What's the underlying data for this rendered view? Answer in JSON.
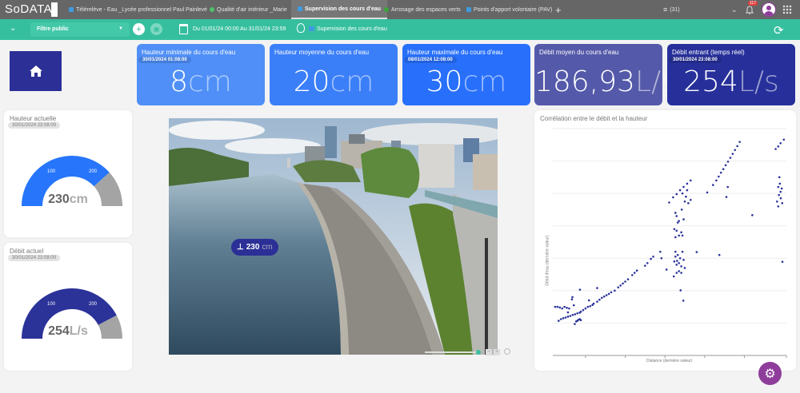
{
  "topbar": {
    "logo": "SoDATA",
    "tabs": [
      {
        "label": "Télérelève - Eau _Lycée professionnel Paul Painlevé",
        "icon": "water-meter-icon",
        "color": "#3f9be0"
      },
      {
        "label": "Qualité d'air intérieur _Marie",
        "icon": "leaf-icon",
        "color": "#4ec06c"
      },
      {
        "label": "Supervision des cours d'eau",
        "icon": "river-icon",
        "color": "#3f9be0",
        "active": true
      },
      {
        "label": "Arrosage des espaces verts",
        "icon": "tree-icon",
        "color": "#3ca53c"
      },
      {
        "label": "Points d'apport volontaire (PAV)",
        "icon": "bin-icon",
        "color": "#3f9be0"
      }
    ],
    "list_count": "(31)",
    "notifications": "117"
  },
  "toolbar": {
    "filter": "Filtre public",
    "date_range": "Du 01/01/24 00:00 Au 31/01/24 23:59",
    "dashboard": "Supervision des cours d'eau"
  },
  "kpis": [
    {
      "title": "Hauteur minimale du cours d'eau",
      "date": "30/01/2024 01:08:00",
      "value": "8",
      "unit": "cm",
      "color": "#4f8ff7"
    },
    {
      "title": "Hauteur moyenne du cours d'eau",
      "value": "20",
      "unit": "cm",
      "color": "#3b7ff8"
    },
    {
      "title": "Hauteur maximale du cours d'eau",
      "date": "08/01/2024 12:08:00",
      "value": "30",
      "unit": "cm",
      "color": "#2870fb"
    },
    {
      "title": "Débit moyen du cours d'eau",
      "value": "186,93",
      "unit": "L/s",
      "color": "#5459a9"
    },
    {
      "title": "Débit entrant (temps réel)",
      "date": "30/01/2024 23:08:00",
      "value": "254",
      "unit": "L/s",
      "color": "#27309a"
    }
  ],
  "gauges": [
    {
      "title": "Hauteur actuelle",
      "date": "30/01/2024 23:08:00",
      "value": "230",
      "unit": "cm",
      "level": 230,
      "max": 300,
      "ticks": [
        "100",
        "200"
      ],
      "color": "#2775fb"
    },
    {
      "title": "Débit actuel",
      "date": "30/01/2024 23:08:00",
      "value": "254",
      "unit": "L/s",
      "level": 254,
      "max": 300,
      "ticks": [
        "100",
        "200"
      ],
      "color": "#2b3399"
    }
  ],
  "photo_marker": {
    "value": "230",
    "unit": "cm"
  },
  "chart_data": {
    "type": "scatter",
    "title": "Corrélation entre le débit et la hauteur",
    "xlabel": "Distance (dernière valeur)",
    "ylabel": "Débit d'eau (dernière valeur)",
    "xlim": [
      0,
      100
    ],
    "ylim": [
      0,
      7
    ],
    "grid": true,
    "color": "#2b3399",
    "points": [
      [
        1,
        1.5
      ],
      [
        2,
        1.5
      ],
      [
        3,
        1.48
      ],
      [
        4,
        1.45
      ],
      [
        5,
        1.5
      ],
      [
        6,
        1.47
      ],
      [
        7,
        1.45
      ],
      [
        2.5,
        1.07
      ],
      [
        3.5,
        1.12
      ],
      [
        4.5,
        1.15
      ],
      [
        5.5,
        1.17
      ],
      [
        6.5,
        1.2
      ],
      [
        7.5,
        1.22
      ],
      [
        8.5,
        1.25
      ],
      [
        9.5,
        1.27
      ],
      [
        10.5,
        1.3
      ],
      [
        11.5,
        1.32
      ],
      [
        12,
        1.35
      ],
      [
        8.2,
        1.73
      ],
      [
        8.4,
        1.8
      ],
      [
        9,
        1.55
      ],
      [
        6.5,
        1.33
      ],
      [
        11.6,
        2.03
      ],
      [
        9.4,
        0.97
      ],
      [
        10,
        1.05
      ],
      [
        10.5,
        1.07
      ],
      [
        11,
        1.1
      ],
      [
        11.5,
        1.12
      ],
      [
        12,
        1.09
      ],
      [
        13,
        1.4
      ],
      [
        14,
        1.45
      ],
      [
        15,
        1.5
      ],
      [
        15.5,
        1.7
      ],
      [
        16,
        1.52
      ],
      [
        17,
        1.56
      ],
      [
        17.5,
        1.6
      ],
      [
        19,
        1.66
      ],
      [
        19,
        2.08
      ],
      [
        20,
        1.72
      ],
      [
        21,
        1.78
      ],
      [
        22,
        1.82
      ],
      [
        23,
        1.86
      ],
      [
        24,
        1.9
      ],
      [
        25,
        1.95
      ],
      [
        26.5,
        2
      ],
      [
        28,
        2.1
      ],
      [
        29,
        2.16
      ],
      [
        30,
        2.22
      ],
      [
        31,
        2.28
      ],
      [
        32.2,
        2.35
      ],
      [
        34,
        2.48
      ],
      [
        35,
        2.55
      ],
      [
        36,
        2.62
      ],
      [
        39.5,
        2.77
      ],
      [
        40.5,
        2.85
      ],
      [
        42,
        2.98
      ],
      [
        43,
        3.05
      ],
      [
        46,
        3.2
      ],
      [
        46.5,
        3
      ],
      [
        48.7,
        2.65
      ],
      [
        51.8,
        2.44
      ],
      [
        52,
        2.9
      ],
      [
        52.5,
        3.05
      ],
      [
        53,
        2.8
      ],
      [
        53.2,
        2.92
      ],
      [
        53.5,
        3.1
      ],
      [
        54,
        2.85
      ],
      [
        54.5,
        3
      ],
      [
        55,
        2.75
      ],
      [
        55.5,
        3.2
      ],
      [
        56,
        2.95
      ],
      [
        52.5,
        3.2
      ],
      [
        54,
        2.6
      ],
      [
        55,
        2.55
      ],
      [
        56.5,
        2.7
      ],
      [
        53,
        2.55
      ],
      [
        54.7,
        2.01
      ],
      [
        55.9,
        1.69
      ],
      [
        52.5,
        4.4
      ],
      [
        53,
        4.3
      ],
      [
        53.5,
        4.1
      ],
      [
        54,
        4.15
      ],
      [
        52,
        3.9
      ],
      [
        53,
        3.85
      ],
      [
        54,
        3.7
      ],
      [
        55.5,
        3.7
      ],
      [
        52.5,
        3.65
      ],
      [
        55,
        3.8
      ],
      [
        55.2,
        4.5
      ],
      [
        56,
        4.2
      ],
      [
        56.5,
        4.75
      ],
      [
        57,
        4.9
      ],
      [
        55.5,
        5.0
      ],
      [
        57.5,
        5.1
      ],
      [
        58,
        4.7
      ],
      [
        59,
        4.8
      ],
      [
        49.8,
        4.72
      ],
      [
        51.5,
        4.88
      ],
      [
        53,
        4.98
      ],
      [
        54.5,
        5.1
      ],
      [
        56,
        5.2
      ],
      [
        57.5,
        5.3
      ],
      [
        59,
        5.4
      ],
      [
        61.6,
        3.19
      ],
      [
        66.1,
        5.03
      ],
      [
        68.6,
        5.26
      ],
      [
        70,
        5.4
      ],
      [
        71,
        5.52
      ],
      [
        72,
        5.64
      ],
      [
        73,
        5.75
      ],
      [
        74,
        5.87
      ],
      [
        75,
        5.98
      ],
      [
        76,
        6.1
      ],
      [
        77,
        6.22
      ],
      [
        78,
        6.34
      ],
      [
        79,
        6.46
      ],
      [
        80,
        6.59
      ],
      [
        74.9,
        5.2
      ],
      [
        74.3,
        4.89
      ],
      [
        71.3,
        3.1
      ],
      [
        85.4,
        4.33
      ],
      [
        95.4,
        6.37
      ],
      [
        96.5,
        6.45
      ],
      [
        97.5,
        6.55
      ],
      [
        98.9,
        6.66
      ],
      [
        97,
        5.5
      ],
      [
        97.2,
        5.3
      ],
      [
        96.5,
        5.2
      ],
      [
        97.5,
        5.05
      ],
      [
        98,
        5.15
      ],
      [
        96.8,
        4.95
      ],
      [
        97.6,
        4.85
      ],
      [
        96,
        4.75
      ],
      [
        98.2,
        4.7
      ],
      [
        96.5,
        4.6
      ],
      [
        98.3,
        2.89
      ]
    ]
  }
}
